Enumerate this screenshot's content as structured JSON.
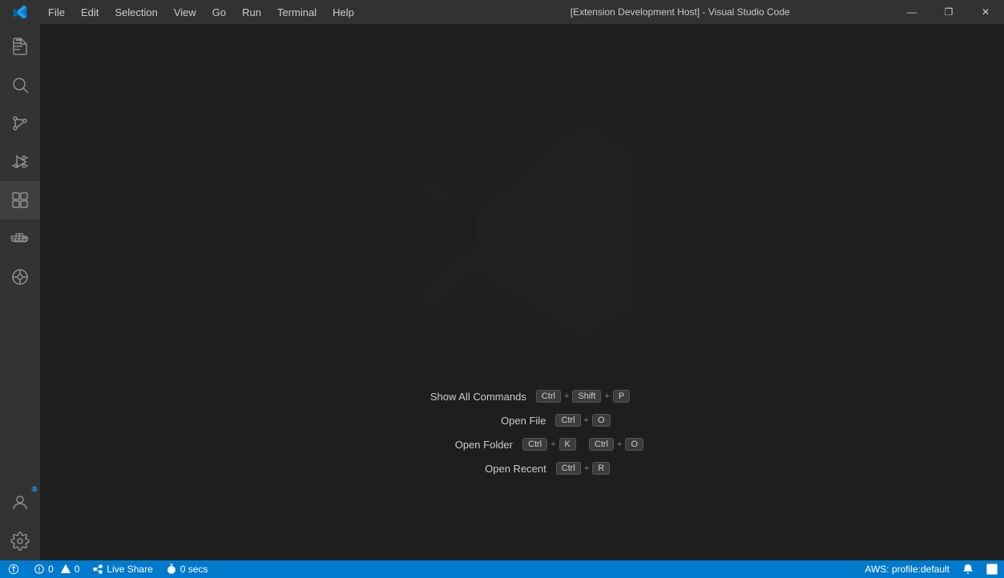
{
  "titlebar": {
    "title": "[Extension Development Host] - Visual Studio Code",
    "menu": [
      "File",
      "Edit",
      "Selection",
      "View",
      "Go",
      "Run",
      "Terminal",
      "Help"
    ],
    "win_minimize": "—",
    "win_maximize": "❐",
    "win_close": "✕"
  },
  "activity_bar": {
    "items": [
      {
        "name": "explorer",
        "tooltip": "Explorer"
      },
      {
        "name": "search",
        "tooltip": "Search"
      },
      {
        "name": "source-control",
        "tooltip": "Source Control"
      },
      {
        "name": "run-debug",
        "tooltip": "Run and Debug"
      },
      {
        "name": "extensions",
        "tooltip": "Extensions"
      },
      {
        "name": "docker",
        "tooltip": "Docker"
      },
      {
        "name": "remote-explorer",
        "tooltip": "Remote Explorer"
      }
    ]
  },
  "quick_actions": [
    {
      "label": "Show All Commands",
      "keys": [
        {
          "groups": [
            [
              "Ctrl"
            ],
            [
              "+"
            ],
            [
              "Shift"
            ],
            [
              "+"
            ],
            [
              "P"
            ]
          ]
        }
      ]
    },
    {
      "label": "Open File",
      "keys": [
        {
          "groups": [
            [
              "Ctrl"
            ],
            [
              "+"
            ],
            [
              "O"
            ]
          ]
        }
      ]
    },
    {
      "label": "Open Folder",
      "keys": [
        {
          "groups": [
            [
              "Ctrl"
            ],
            [
              "+"
            ],
            [
              "K"
            ]
          ]
        },
        {
          "groups": [
            [
              "Ctrl"
            ],
            [
              "+"
            ],
            [
              "O"
            ]
          ]
        }
      ]
    },
    {
      "label": "Open Recent",
      "keys": [
        {
          "groups": [
            [
              "Ctrl"
            ],
            [
              "+"
            ],
            [
              "R"
            ]
          ]
        }
      ]
    }
  ],
  "status_bar": {
    "errors": "0",
    "warnings": "0",
    "live_share": "Live Share",
    "timer": "0 secs",
    "profile": "AWS: profile:default"
  }
}
